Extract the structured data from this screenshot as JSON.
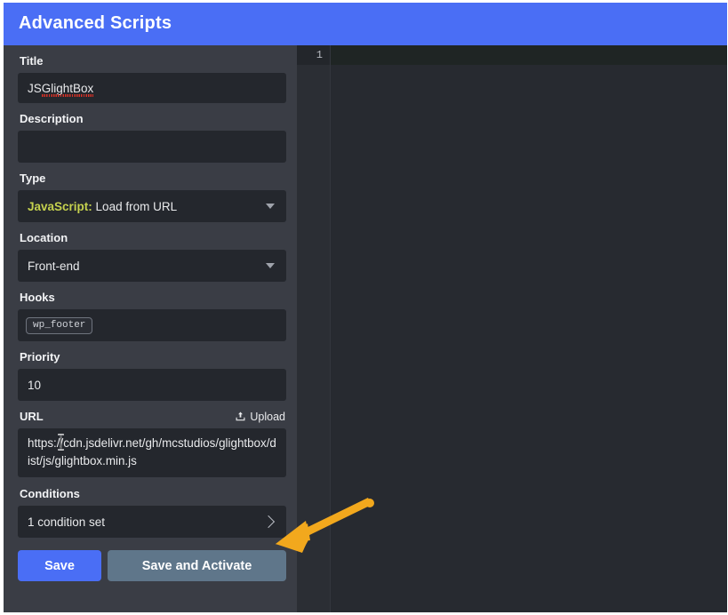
{
  "header": {
    "title": "Advanced Scripts",
    "accent_color": "#4a6ef5"
  },
  "form": {
    "title_label": "Title",
    "title_value_prefix": "JS ",
    "title_value_misspelled": "GlightBox",
    "description_label": "Description",
    "description_value": "",
    "description_placeholder": "",
    "type_label": "Type",
    "type_value_keyword": "JavaScript:",
    "type_value_rest": " Load from URL",
    "location_label": "Location",
    "location_value": "Front-end",
    "hooks_label": "Hooks",
    "hooks_chips": [
      "wp_footer"
    ],
    "priority_label": "Priority",
    "priority_value": "10",
    "url_label": "URL",
    "upload_label": "Upload",
    "upload_icon": "upload-icon",
    "url_value": "https://cdn.jsdelivr.net/gh/mcstudios/glightbox/dist/js/glightbox.min.js",
    "conditions_label": "Conditions",
    "conditions_value": "1 condition set",
    "conditions_chevron_icon": "chevron-right-icon",
    "dropdown_icon": "chevron-down-icon"
  },
  "buttons": {
    "save_label": "Save",
    "save_color": "#4a6ef5",
    "save_activate_label": "Save and Activate",
    "save_activate_color": "#5f768a"
  },
  "editor": {
    "line_numbers": [
      "1"
    ],
    "code_lines": [
      ""
    ],
    "background_color": "#272a30",
    "active_line_color": "#1f2524"
  },
  "annotation": {
    "arrow_icon": "arrow-pointer-icon",
    "arrow_color": "#f2a81d",
    "points_to": "conditions-row"
  }
}
